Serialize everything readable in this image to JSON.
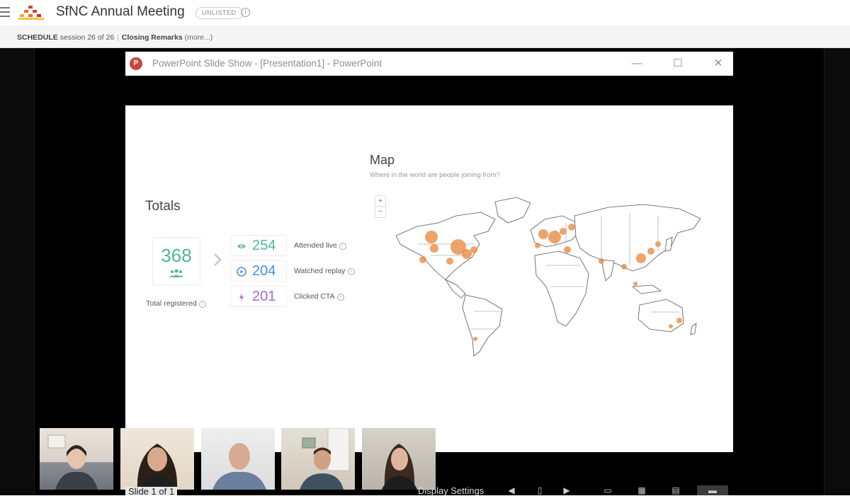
{
  "header": {
    "event_title": "SfNC Annual Meeting",
    "visibility_badge": "UNLISTED",
    "info_icon": "info-icon"
  },
  "schedule": {
    "label": "SCHEDULE",
    "session_position": "session 26 of 26",
    "session_title": "Closing Remarks",
    "more_link": "(more...)"
  },
  "ppt_window": {
    "title": "PowerPoint Slide Show - [Presentation1] - PowerPoint",
    "app_icon_letter": "P",
    "buttons": [
      "minimize-icon",
      "maximize-icon",
      "close-icon"
    ]
  },
  "slide": {
    "totals": {
      "heading": "Totals",
      "total_registered": "368",
      "total_registered_label": "Total registered",
      "stats": [
        {
          "value": "254",
          "label": "Attended live",
          "icon": "eye-icon",
          "color": "#4fb59b"
        },
        {
          "value": "204",
          "label": "Watched replay",
          "icon": "play-circle-icon",
          "color": "#4a90d9"
        },
        {
          "value": "201",
          "label": "Clicked CTA",
          "icon": "bolt-icon",
          "color": "#a56bd0"
        }
      ]
    },
    "map": {
      "heading": "Map",
      "subtitle": "Where in the world are people joining from?",
      "zoom_in": "+",
      "zoom_out": "−",
      "marker_color": "#e8843a"
    }
  },
  "participants": [
    {
      "name": "participant-1"
    },
    {
      "name": "participant-2"
    },
    {
      "name": "participant-3"
    },
    {
      "name": "participant-4"
    },
    {
      "name": "participant-5"
    }
  ],
  "controls": {
    "slide_counter": "Slide 1 of 1",
    "display_settings": "Display Settings"
  }
}
